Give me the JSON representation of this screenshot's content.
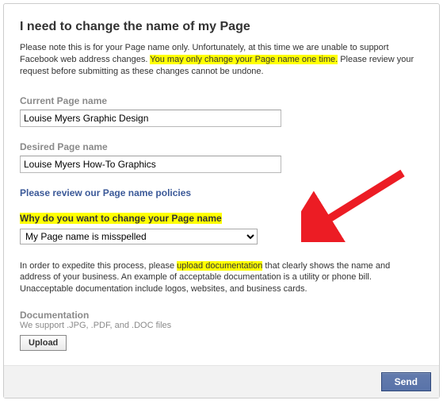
{
  "heading": "I need to change the name of my Page",
  "intro_before": "Please note this is for your Page name only. Unfortunately, at this time we are unable to support Facebook web address changes. ",
  "intro_highlight": "You may only change your Page name one time.",
  "intro_after": " Please review your request before submitting as these changes cannot be undone.",
  "current": {
    "label": "Current Page name",
    "value": "Louise Myers Graphic Design"
  },
  "desired": {
    "label": "Desired Page name",
    "value": "Louise Myers How-To Graphics"
  },
  "policies_link": "Please review our Page name policies",
  "why": {
    "label": "Why do you want to change your Page name",
    "selected": "My Page name is misspelled"
  },
  "explain_before": "In order to expedite this process, please ",
  "explain_highlight": "upload documentation",
  "explain_after": " that clearly shows the name and address of your business. An example of acceptable documentation is a utility or phone bill. Unacceptable documentation include logos, websites, and business cards.",
  "doc": {
    "label": "Documentation",
    "support": "We support .JPG, .PDF, and .DOC files",
    "upload": "Upload"
  },
  "send": "Send"
}
